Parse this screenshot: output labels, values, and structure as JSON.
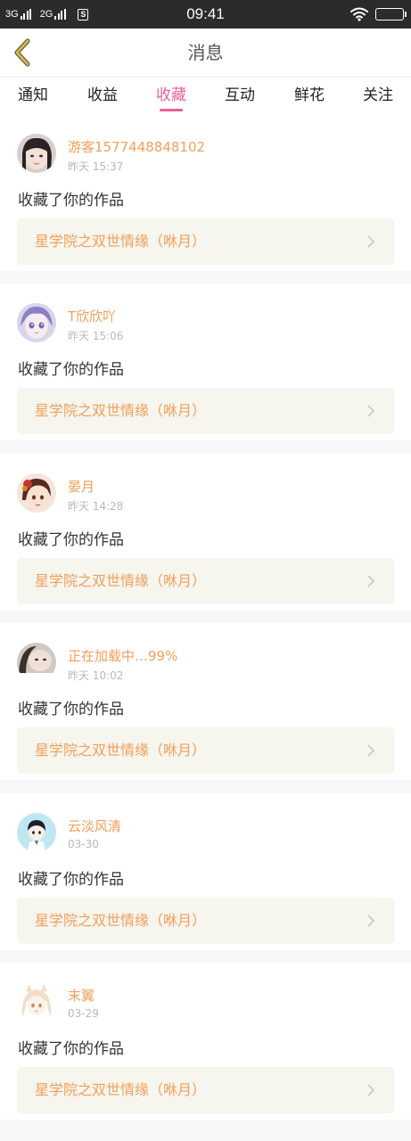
{
  "status_bar": {
    "network_1": "3G",
    "network_2": "2G",
    "sim_badge": "S",
    "time": "09:41",
    "icons": [
      "signal-icon",
      "wifi-icon",
      "battery-icon"
    ]
  },
  "header": {
    "title": "消息",
    "back_icon": "chevron-left-icon"
  },
  "tabs": [
    {
      "label": "通知"
    },
    {
      "label": "收益"
    },
    {
      "label": "收藏",
      "active": true
    },
    {
      "label": "互动"
    },
    {
      "label": "鲜花"
    },
    {
      "label": "关注"
    }
  ],
  "notifications": [
    {
      "user": "游客1577448848102",
      "time": "昨天 15:37",
      "action": "收藏了你的作品",
      "work": "星学院之双世情缘（咻月）"
    },
    {
      "user": "T欣欣吖",
      "time": "昨天 15:06",
      "action": "收藏了你的作品",
      "work": "星学院之双世情缘（咻月）"
    },
    {
      "user": "晏月",
      "time": "昨天 14:28",
      "action": "收藏了你的作品",
      "work": "星学院之双世情缘（咻月）"
    },
    {
      "user": "正在加载中…99%",
      "time": "昨天 10:02",
      "action": "收藏了你的作品",
      "work": "星学院之双世情缘（咻月）"
    },
    {
      "user": "云淡风清",
      "time": "03-30",
      "action": "收藏了你的作品",
      "work": "星学院之双世情缘（咻月）"
    },
    {
      "user": "末翼",
      "time": "03-29",
      "action": "收藏了你的作品",
      "work": "星学院之双世情缘（咻月）"
    }
  ],
  "colors": {
    "accent_pink": "#e8609a",
    "name_orange": "#f0a05a",
    "work_bg": "#f6f5ee",
    "back_icon": "#c9a227"
  }
}
